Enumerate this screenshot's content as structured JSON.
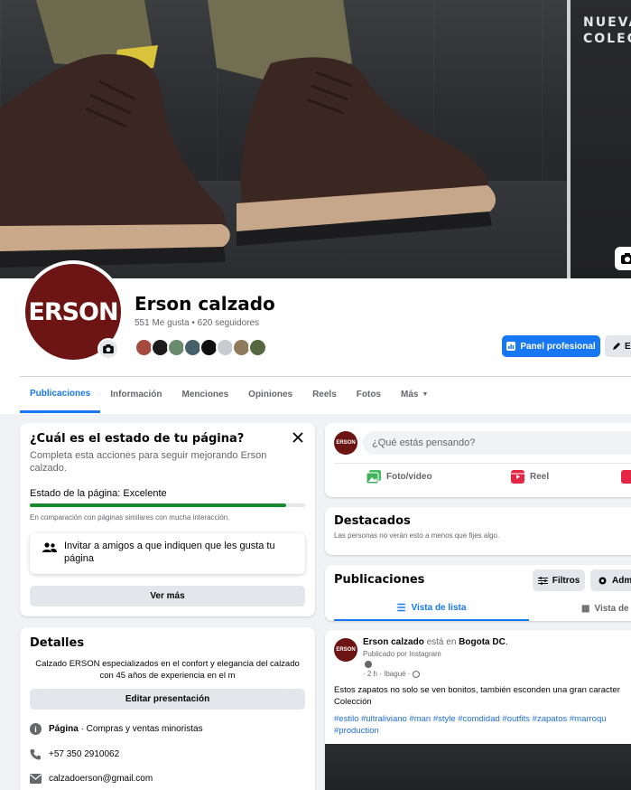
{
  "cover": {
    "overlay_text_1": "NUEVA",
    "overlay_text_2": "COLEC"
  },
  "profile": {
    "avatar_text": "ERSON",
    "name": "Erson calzado",
    "stats": "551 Me gusta • 620 seguidores",
    "panel_button": "Panel profesional",
    "edit_button": "E"
  },
  "tabs": [
    {
      "label": "Publicaciones"
    },
    {
      "label": "Información"
    },
    {
      "label": "Menciones"
    },
    {
      "label": "Opiniones"
    },
    {
      "label": "Reels"
    },
    {
      "label": "Fotos"
    },
    {
      "label": "Más"
    }
  ],
  "status_card": {
    "title": "¿Cuál es el estado de tu página?",
    "subtitle": "Completa esta acciones para seguir mejorando Erson calzado.",
    "status_label": "Estado de la página: Excelente",
    "progress": 0.93,
    "comparison": "En comparación con páginas similares con mucha interacción.",
    "invite_text": "Invitar a amigos a que indiquen que les gusta tu página",
    "more_button": "Ver más"
  },
  "details": {
    "title": "Detalles",
    "bio": "Calzado ERSON especializados en el confort y elegancia del calzado con 45 años de experiencia en el m",
    "edit_button": "Editar presentación",
    "category_label": "Página",
    "category_value": " · Compras y ventas minoristas",
    "phone": "+57 350 2910062",
    "email": "calzadoerson@gmail.com"
  },
  "composer": {
    "avatar_text": "ERSON",
    "placeholder": "¿Qué estás pensando?",
    "photo_label": "Foto/video",
    "reel_label": "Reel"
  },
  "featured": {
    "title": "Destacados",
    "subtitle": "Las personas no verán esto a menos que fijes algo."
  },
  "posts_section": {
    "title": "Publicaciones",
    "filters_button": "Filtros",
    "admin_button": "Adm",
    "list_view": "Vista de lista",
    "grid_view": "Vista de c"
  },
  "post": {
    "avatar_text": "ERSON",
    "author": "Erson calzado",
    "location_prefix": " está en ",
    "location": "Bogota DC",
    "location_suffix": ".",
    "published_via": "Publicado por Instagram",
    "meta": "· 2 h · Ibagué ·",
    "text": "Estos zapatos no solo se ven bonitos, también esconden una gran caracter Colección",
    "hashtags": "#estilo #ultraliviano #man #style #comdidad #outfits #zapatos #marroqu #production"
  },
  "colors": {
    "accent": "#1877f2",
    "brand": "#6d1414",
    "progress": "#1a8a2f"
  }
}
